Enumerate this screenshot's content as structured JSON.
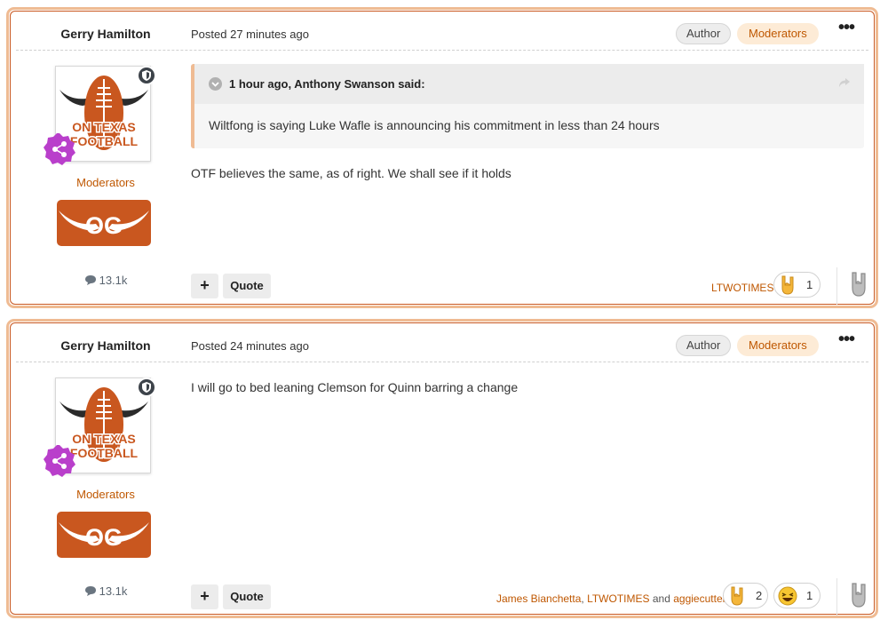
{
  "posts": [
    {
      "author": "Gerry Hamilton",
      "date": "Posted 27 minutes ago",
      "badge_author": "Author",
      "badge_group": "Moderators",
      "more": "•••",
      "avatar_line1": "ON TEXAS",
      "avatar_line2": "FOOTBALL",
      "group_label": "Moderators",
      "og_text": "OG",
      "post_count": "13.1k",
      "quote": {
        "citation": "1 hour ago, Anthony Swanson said:",
        "text": "Wiltfong is saying Luke Wafle is announcing his commitment in less than 24 hours"
      },
      "body": "OTF believes the same, as of right. We shall see if it holds",
      "plus_label": "+",
      "quote_label": "Quote",
      "reactors": {
        "names": [
          "LTWOTIMES"
        ],
        "joiner": "",
        "last": ""
      },
      "reactions": [
        {
          "icon": "horns-icon",
          "count": "1"
        }
      ]
    },
    {
      "author": "Gerry Hamilton",
      "date": "Posted 24 minutes ago",
      "badge_author": "Author",
      "badge_group": "Moderators",
      "more": "•••",
      "avatar_line1": "ON TEXAS",
      "avatar_line2": "FOOTBALL",
      "group_label": "Moderators",
      "og_text": "OG",
      "post_count": "13.1k",
      "body": "I will go to bed leaning Clemson for Quinn barring a change",
      "plus_label": "+",
      "quote_label": "Quote",
      "reactors": {
        "names": [
          "James Bianchetta",
          "LTWOTIMES"
        ],
        "joiner": "and",
        "last": "aggiecutter"
      },
      "reactions": [
        {
          "icon": "horns-icon",
          "count": "2"
        },
        {
          "icon": "laughing-face-icon",
          "count": "1"
        }
      ]
    }
  ],
  "colors": {
    "accent": "#bf5700",
    "frame": "#efbb93",
    "frame_inner": "#c9571f"
  }
}
